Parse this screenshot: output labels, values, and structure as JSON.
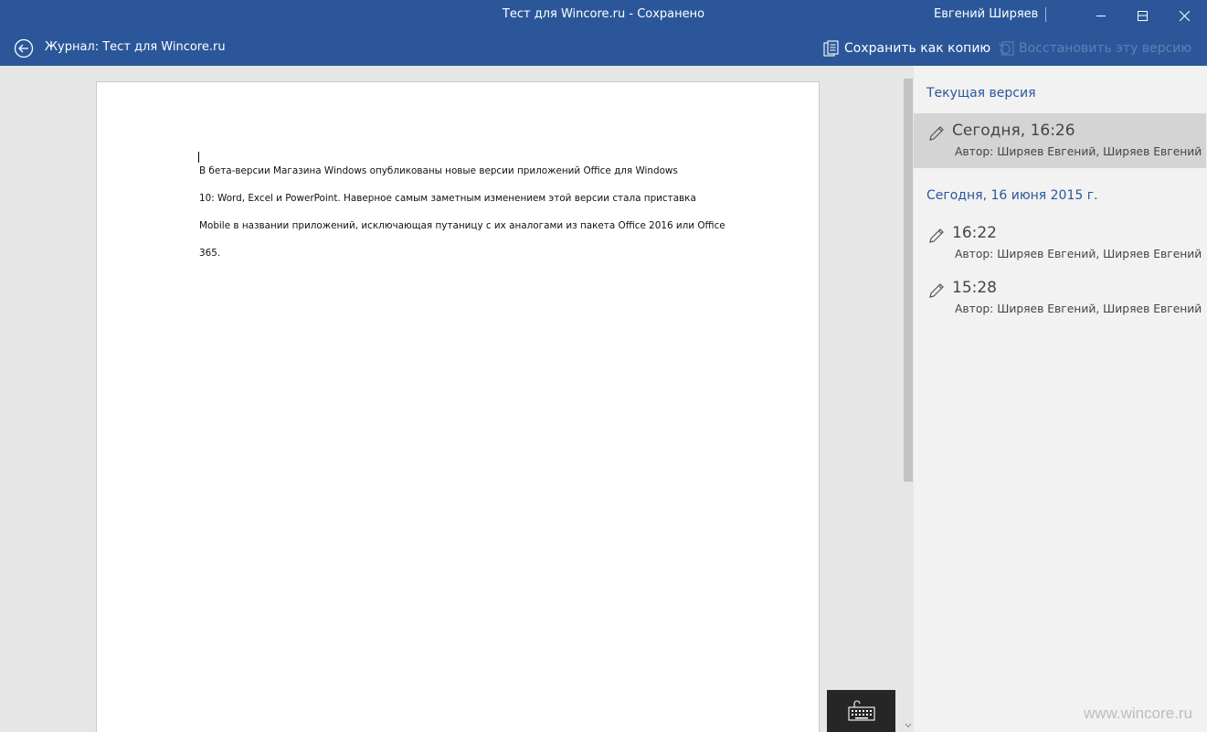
{
  "window": {
    "title": "Тест для Wincore.ru - Сохранено",
    "user_name": "Евгений Ширяев",
    "controls": [
      "minimize-icon",
      "maximize-icon",
      "close-icon"
    ]
  },
  "toolbar": {
    "back_icon": "back-arrow-circle-icon",
    "journal_title": "Журнал: Тест для Wincore.ru",
    "save_copy_label": "Сохранить как копию",
    "save_copy_icon": "document-copy-icon",
    "restore_label": "Восстановить эту версию",
    "restore_icon": "restore-icon"
  },
  "document": {
    "lines": [
      "В бета-версии Магазина Windows опубликованы новые версии приложений Office для Windows",
      "10: Word, Excel и PowerPoint. Наверное самым заметным изменением этой версии стала приставка",
      "Mobile в названии приложений, исключающая путаницу с их аналогами из пакета Office 2016 или Office",
      "365."
    ],
    "keyboard_icon": "touch-keyboard-icon"
  },
  "history": {
    "current_header": "Текущая версия",
    "current_item": {
      "time": "Сегодня, 16:26",
      "author": "Автор: Ширяев Евгений, Ширяев Евгений",
      "icon": "pencil-icon"
    },
    "date_header": "Сегодня, 16 июня 2015 г.",
    "items": [
      {
        "time": "16:22",
        "author": "Автор: Ширяев Евгений, Ширяев Евгений",
        "icon": "pencil-icon"
      },
      {
        "time": "15:28",
        "author": "Автор: Ширяев Евгений, Ширяев Евгений",
        "icon": "pencil-icon"
      }
    ]
  },
  "watermark": "www.wincore.ru",
  "colors": {
    "accent": "#2b579a",
    "panel_bg": "#f2f2f2",
    "selected_bg": "#d4d4d4",
    "canvas_bg": "#e6e6e6",
    "disabled_text": "#5f7fb4"
  }
}
